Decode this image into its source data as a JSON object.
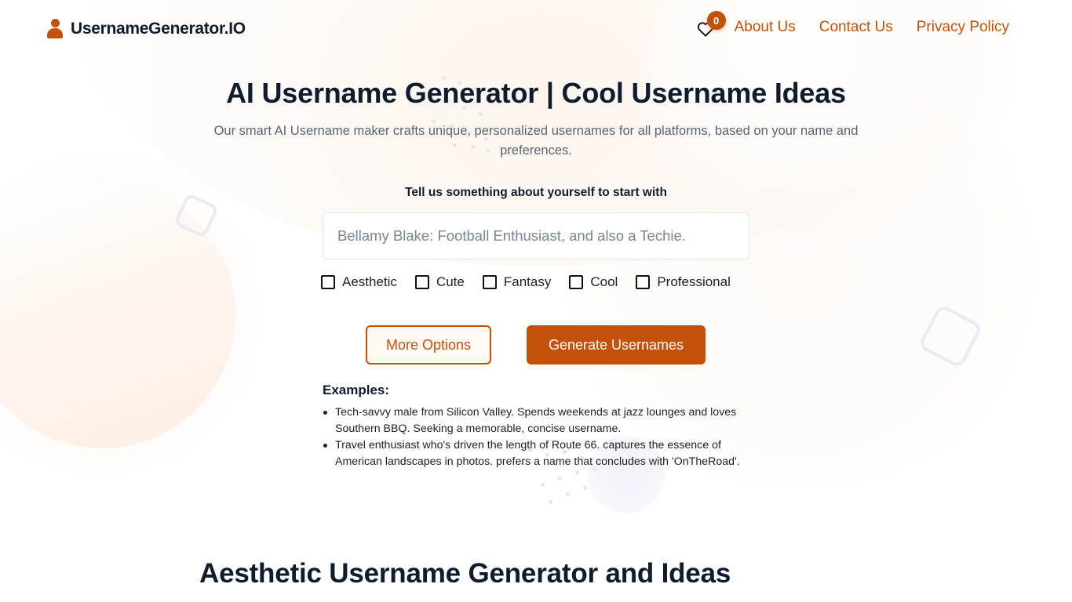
{
  "brand": {
    "name": "UsernameGenerator.IO",
    "icon": "user-icon",
    "accent_color": "#c4510a",
    "text_color": "#0f1c2e"
  },
  "nav": {
    "favorites": {
      "icon": "heart-icon",
      "count": "0"
    },
    "links": [
      {
        "label": "About Us"
      },
      {
        "label": "Contact Us"
      },
      {
        "label": "Privacy Policy"
      }
    ]
  },
  "hero": {
    "title": "AI Username Generator | Cool Username Ideas",
    "subtitle": "Our smart AI Username maker crafts unique, personalized usernames for all platforms, based on your name and preferences."
  },
  "form": {
    "prompt_label": "Tell us something about yourself to start with",
    "input": {
      "value": "",
      "placeholder": "Bellamy Blake: Football Enthusiast, and also a Techie."
    },
    "styles": [
      {
        "label": "Aesthetic",
        "checked": false
      },
      {
        "label": "Cute",
        "checked": false
      },
      {
        "label": "Fantasy",
        "checked": false
      },
      {
        "label": "Cool",
        "checked": false
      },
      {
        "label": "Professional",
        "checked": false
      }
    ],
    "more_options_label": "More Options",
    "generate_label": "Generate Usernames"
  },
  "examples": {
    "title": "Examples:",
    "items": [
      "Tech-savvy male from Silicon Valley. Spends weekends at jazz lounges and loves Southern BBQ. Seeking a memorable, concise username.",
      "Travel enthusiast who's driven the length of Route 66. captures the essence of American landscapes in photos. prefers a name that concludes with 'OnTheRoad'."
    ]
  },
  "next_section": {
    "title": "Aesthetic Username Generator and Ideas"
  }
}
